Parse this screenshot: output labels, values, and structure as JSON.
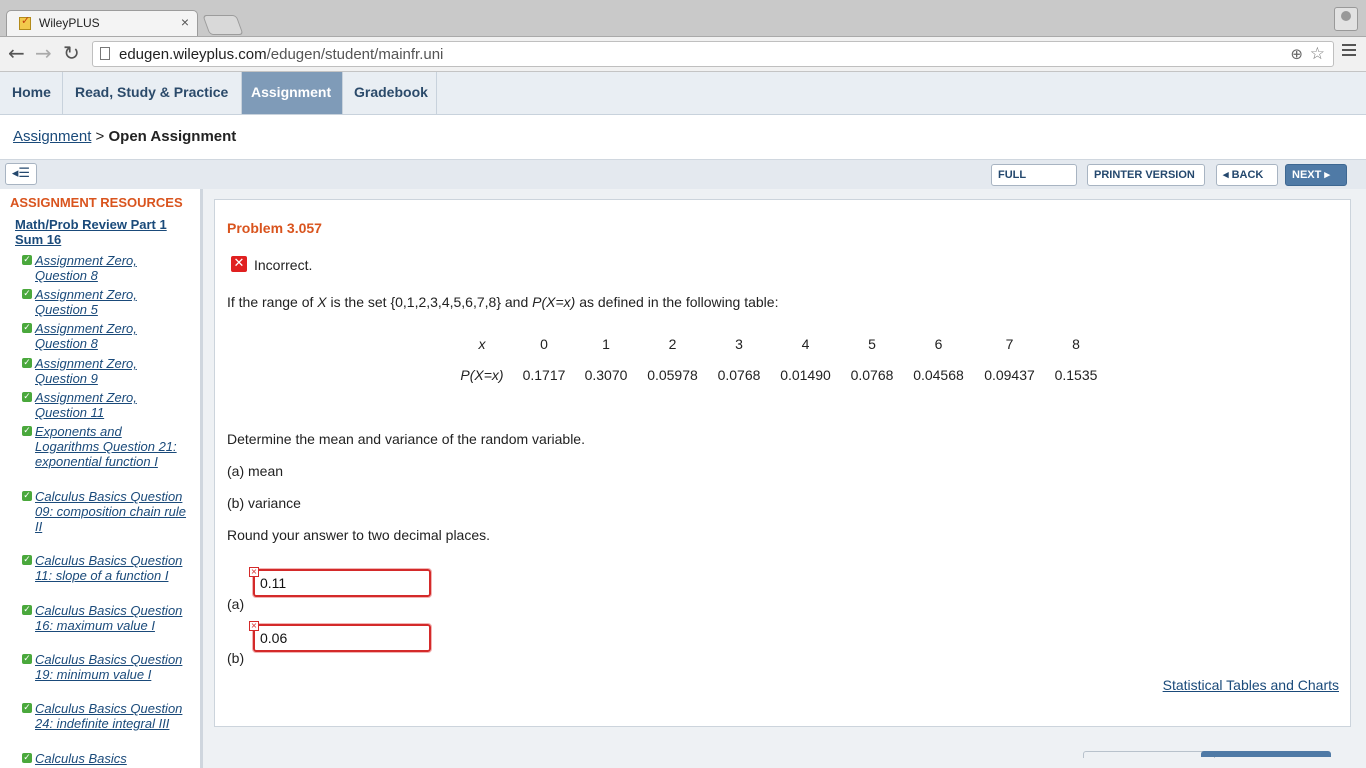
{
  "browser": {
    "tab_title": "WileyPLUS",
    "tab_close": "×",
    "url_host": "edugen.wileyplus.com",
    "url_path": "/edugen/student/mainfr.uni"
  },
  "nav": {
    "tabs": [
      {
        "label": "Home"
      },
      {
        "label": "Read, Study & Practice"
      },
      {
        "label": "Assignment",
        "active": true
      },
      {
        "label": "Gradebook"
      }
    ]
  },
  "breadcrumb": {
    "link": "Assignment",
    "separator": ">",
    "current": "Open Assignment"
  },
  "actions": {
    "full_screen": "FULL SCREEN",
    "printer_version": "PRINTER VERSION",
    "back": "◂ BACK",
    "next": "NEXT ▸"
  },
  "sidebar": {
    "heading": "ASSIGNMENT RESOURCES",
    "section": "Math/Prob Review Part 1 Sum 16",
    "items": [
      {
        "label": "Assignment Zero, Question 8"
      },
      {
        "label": "Assignment Zero, Question 5"
      },
      {
        "label": "Assignment Zero, Question 8"
      },
      {
        "label": "Assignment Zero, Question 9"
      },
      {
        "label": "Assignment Zero, Question 11"
      },
      {
        "label": "Exponents and Logarithms Question 21: exponential function I"
      },
      {
        "label": "Calculus Basics Question 09: composition chain rule II"
      },
      {
        "label": "Calculus Basics Question 11: slope of a function I"
      },
      {
        "label": "Calculus Basics Question 16: maximum value I"
      },
      {
        "label": "Calculus Basics Question 19: minimum value I"
      },
      {
        "label": "Calculus Basics Question 24: indefinite integral III"
      },
      {
        "label": "Calculus Basics"
      }
    ]
  },
  "problem": {
    "title": "Problem 3.057",
    "status": "Incorrect.",
    "intro_a": "If the range of ",
    "intro_x": "X",
    "intro_b": " is the set {0,1,2,3,4,5,6,7,8} and ",
    "intro_p": "P(X=x)",
    "intro_c": " as defined in the following table:",
    "table": {
      "row1_label": "x",
      "row2_label": "P(X=x)",
      "x": [
        "0",
        "1",
        "2",
        "3",
        "4",
        "5",
        "6",
        "7",
        "8"
      ],
      "p": [
        "0.1717",
        "0.3070",
        "0.05978",
        "0.0768",
        "0.01490",
        "0.0768",
        "0.04568",
        "0.09437",
        "0.1535"
      ]
    },
    "question": "Determine the mean and variance of the random variable.",
    "part_a": "(a) mean",
    "part_b": "(b) variance",
    "round_note": "Round your answer to two decimal places.",
    "answer_a_label": "(a)",
    "answer_a_value": "0.11",
    "answer_b_label": "(b)",
    "answer_b_value": "0.06",
    "stat_link": "Statistical Tables and Charts"
  },
  "colors": {
    "accent": "#d9541e",
    "nav_active": "#7f9bb8",
    "link": "#1a4a7a",
    "error": "#d42a2a",
    "check": "#4aa83c"
  }
}
